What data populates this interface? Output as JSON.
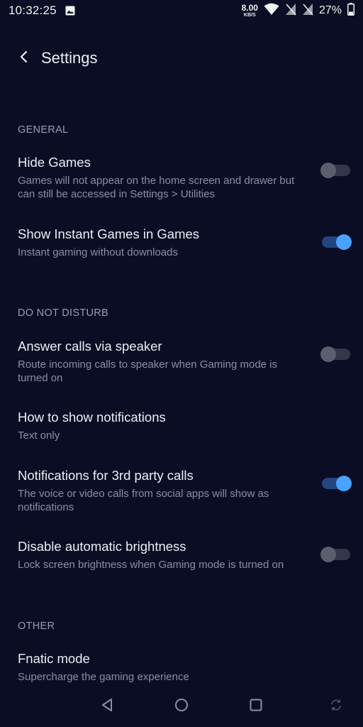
{
  "status_bar": {
    "time": "10:32:25",
    "net_speed_value": "8.00",
    "net_speed_unit": "KB/S",
    "battery_percent": "27%",
    "icons": [
      "image-icon",
      "wifi-icon",
      "no-sim-icon",
      "no-sim-icon",
      "battery-icon"
    ]
  },
  "app_bar": {
    "title": "Settings",
    "back_icon": "chevron-left-icon"
  },
  "sections": {
    "general": {
      "header": "GENERAL",
      "hide_games": {
        "title": "Hide Games",
        "description": "Games will not appear on the home screen and drawer but can still be accessed in Settings > Utilities",
        "enabled": false
      },
      "instant_games": {
        "title": "Show Instant Games in Games",
        "description": "Instant gaming without downloads",
        "enabled": true
      }
    },
    "dnd": {
      "header": "DO NOT DISTURB",
      "answer_calls": {
        "title": "Answer calls via speaker",
        "description": "Route incoming calls to speaker when Gaming mode is turned on",
        "enabled": false
      },
      "notifications": {
        "title": "How to show notifications",
        "description": "Text only"
      },
      "third_party_calls": {
        "title": "Notifications for 3rd party calls",
        "description": "The voice or video calls from social apps will show as notifications",
        "enabled": true
      },
      "brightness": {
        "title": "Disable automatic brightness",
        "description": "Lock screen brightness when Gaming mode is turned on",
        "enabled": false
      }
    },
    "other": {
      "header": "OTHER",
      "fnatic": {
        "title": "Fnatic mode",
        "description": "Supercharge the gaming experience"
      }
    }
  },
  "nav_bar": {
    "icons": [
      "back-triangle-icon",
      "home-circle-icon",
      "recents-square-icon",
      "rotate-icon"
    ]
  },
  "colors": {
    "background": "#0b0d24",
    "accent": "#4aa2ff",
    "toggle_off_thumb": "#5c5e70"
  }
}
